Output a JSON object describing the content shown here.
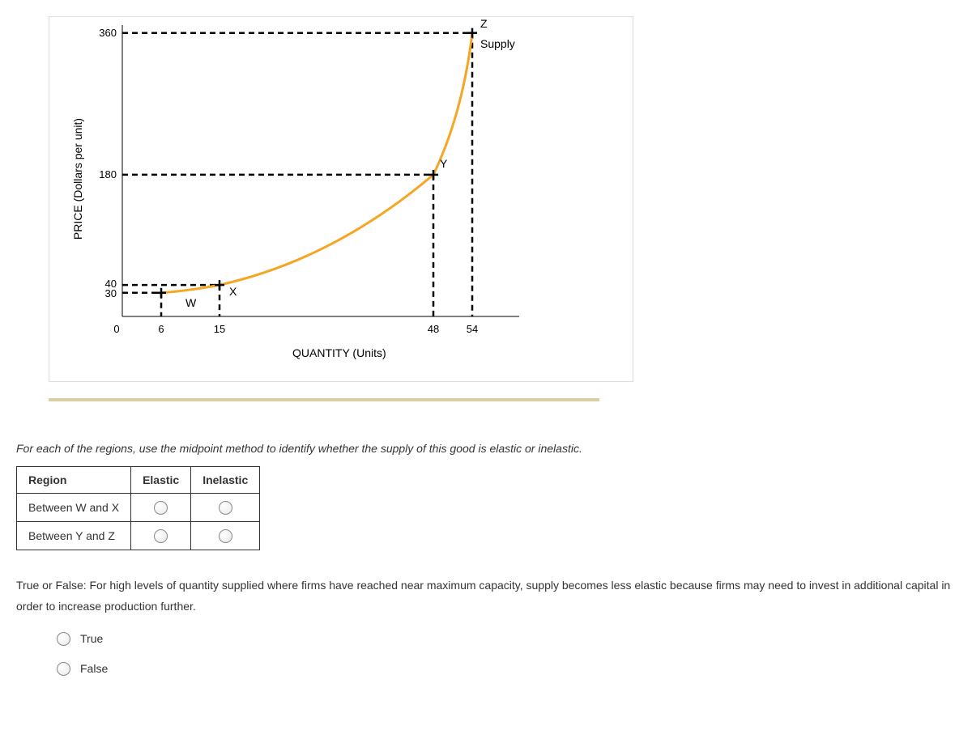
{
  "chart_data": {
    "type": "line",
    "title": "",
    "xlabel": "QUANTITY (Units)",
    "ylabel": "PRICE (Dollars per unit)",
    "xlim": [
      0,
      60
    ],
    "ylim": [
      0,
      370
    ],
    "x_ticks": [
      0,
      6,
      15,
      48,
      54
    ],
    "y_ticks": [
      30,
      40,
      180,
      360
    ],
    "series": [
      {
        "name": "Supply",
        "x": [
          6,
          15,
          48,
          54
        ],
        "y": [
          30,
          40,
          180,
          360
        ]
      }
    ],
    "points": [
      {
        "label": "W",
        "x": 6,
        "y": 30
      },
      {
        "label": "X",
        "x": 15,
        "y": 40
      },
      {
        "label": "Y",
        "x": 48,
        "y": 180
      },
      {
        "label": "Z",
        "x": 54,
        "y": 360
      }
    ],
    "legend": [
      "Supply"
    ]
  },
  "question1": "For each of the regions, use the midpoint method to identify whether the supply of this good is elastic or inelastic.",
  "table": {
    "headers": {
      "region": "Region",
      "elastic": "Elastic",
      "inelastic": "Inelastic"
    },
    "rows": [
      {
        "region": "Between W and X"
      },
      {
        "region": "Between Y and Z"
      }
    ]
  },
  "question2": "True or False: For high levels of quantity supplied where firms have reached near maximum capacity, supply becomes less elastic because firms may need to invest in additional capital in order to increase production further.",
  "tf": {
    "true": "True",
    "false": "False"
  },
  "labels": {
    "supply": "Supply",
    "W": "W",
    "X": "X",
    "Y": "Y",
    "Z": "Z",
    "x0": "0",
    "x6": "6",
    "x15": "15",
    "x48": "48",
    "x54": "54",
    "y30": "30",
    "y40": "40",
    "y180": "180",
    "y360": "360"
  }
}
